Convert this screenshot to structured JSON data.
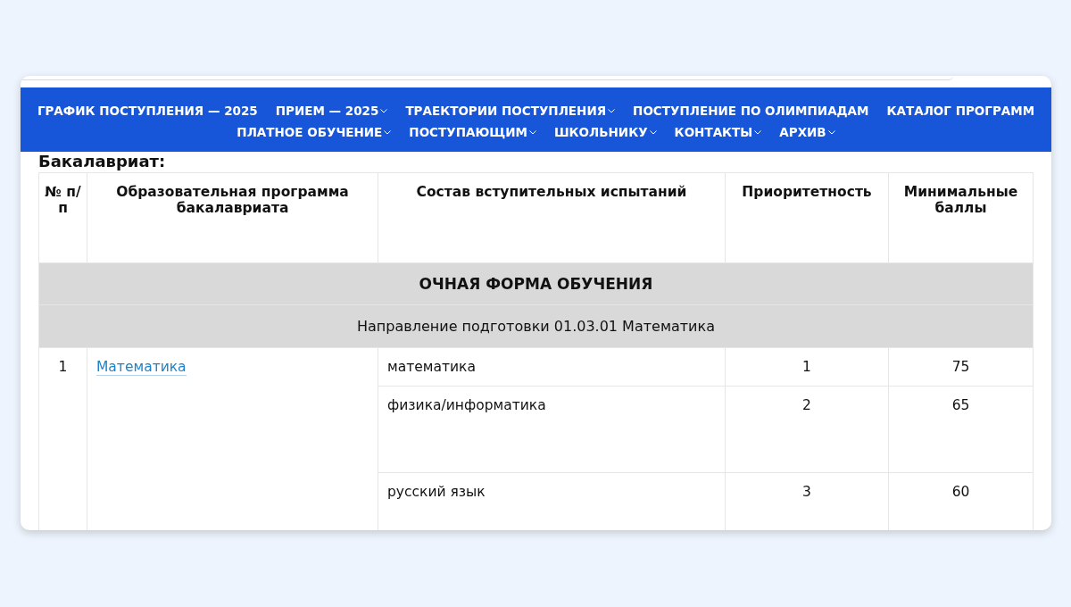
{
  "nav": [
    {
      "label": "ГРАФИК ПОСТУПЛЕНИЯ — 2025",
      "has_dropdown": false
    },
    {
      "label": "ПРИЕМ — 2025",
      "has_dropdown": true
    },
    {
      "label": "ТРАЕКТОРИИ ПОСТУПЛЕНИЯ",
      "has_dropdown": true
    },
    {
      "label": "ПОСТУПЛЕНИЕ ПО ОЛИМПИАДАМ",
      "has_dropdown": false
    },
    {
      "label": "КАТАЛОГ ПРОГРАММ",
      "has_dropdown": false
    },
    {
      "label": "ПЛАТНОЕ ОБУЧЕНИЕ",
      "has_dropdown": true
    },
    {
      "label": "ПОСТУПАЮЩИМ",
      "has_dropdown": true
    },
    {
      "label": "ШКОЛЬНИКУ",
      "has_dropdown": true
    },
    {
      "label": "КОНТАКТЫ",
      "has_dropdown": true
    },
    {
      "label": "АРХИВ",
      "has_dropdown": true
    }
  ],
  "heading": "Бакалавриат:",
  "table": {
    "columns": [
      "№ п/п",
      "Образовательная программа бакалавриата",
      "Состав вступительных испытаний",
      "Приоритетность",
      "Минимальные баллы"
    ],
    "section": "ОЧНАЯ ФОРМА ОБУЧЕНИЯ",
    "direction": "Направление подготовки 01.03.01 Математика",
    "rows": [
      {
        "number": "1",
        "program": "Математика",
        "exams": [
          {
            "subject": "математика",
            "priority": "1",
            "min_score": "75"
          },
          {
            "subject": "физика/информатика",
            "priority": "2",
            "min_score": "65"
          },
          {
            "subject": "русский язык",
            "priority": "3",
            "min_score": "60"
          }
        ]
      }
    ]
  }
}
